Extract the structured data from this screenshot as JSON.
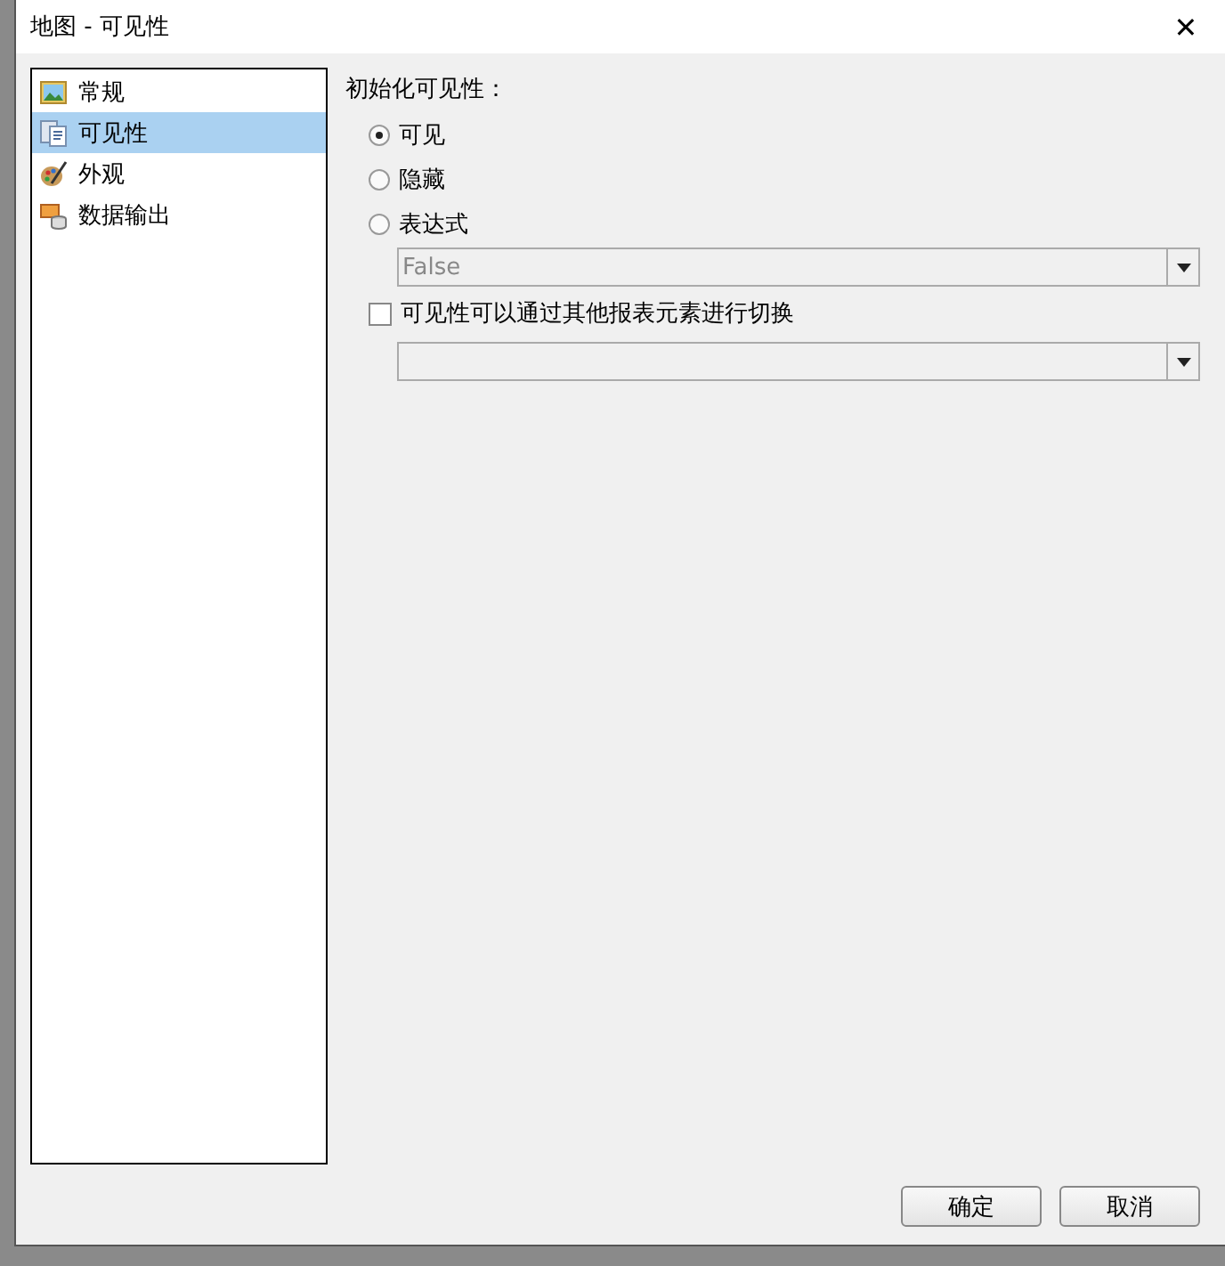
{
  "window": {
    "title": "地图 - 可见性",
    "close": "✕"
  },
  "sidebar": {
    "items": [
      {
        "label": "常规",
        "selected": false
      },
      {
        "label": "可见性",
        "selected": true
      },
      {
        "label": "外观",
        "selected": false
      },
      {
        "label": "数据输出",
        "selected": false
      }
    ]
  },
  "visibility": {
    "heading": "初始化可见性：",
    "options": [
      {
        "label": "可见",
        "selected": true
      },
      {
        "label": "隐藏",
        "selected": false
      },
      {
        "label": "表达式",
        "selected": false
      }
    ],
    "expression": {
      "value": "False",
      "disabled": true
    },
    "toggle": {
      "label": "可见性可以通过其他报表元素进行切换",
      "checked": false
    }
  },
  "buttons": [
    "确定",
    "取消"
  ]
}
